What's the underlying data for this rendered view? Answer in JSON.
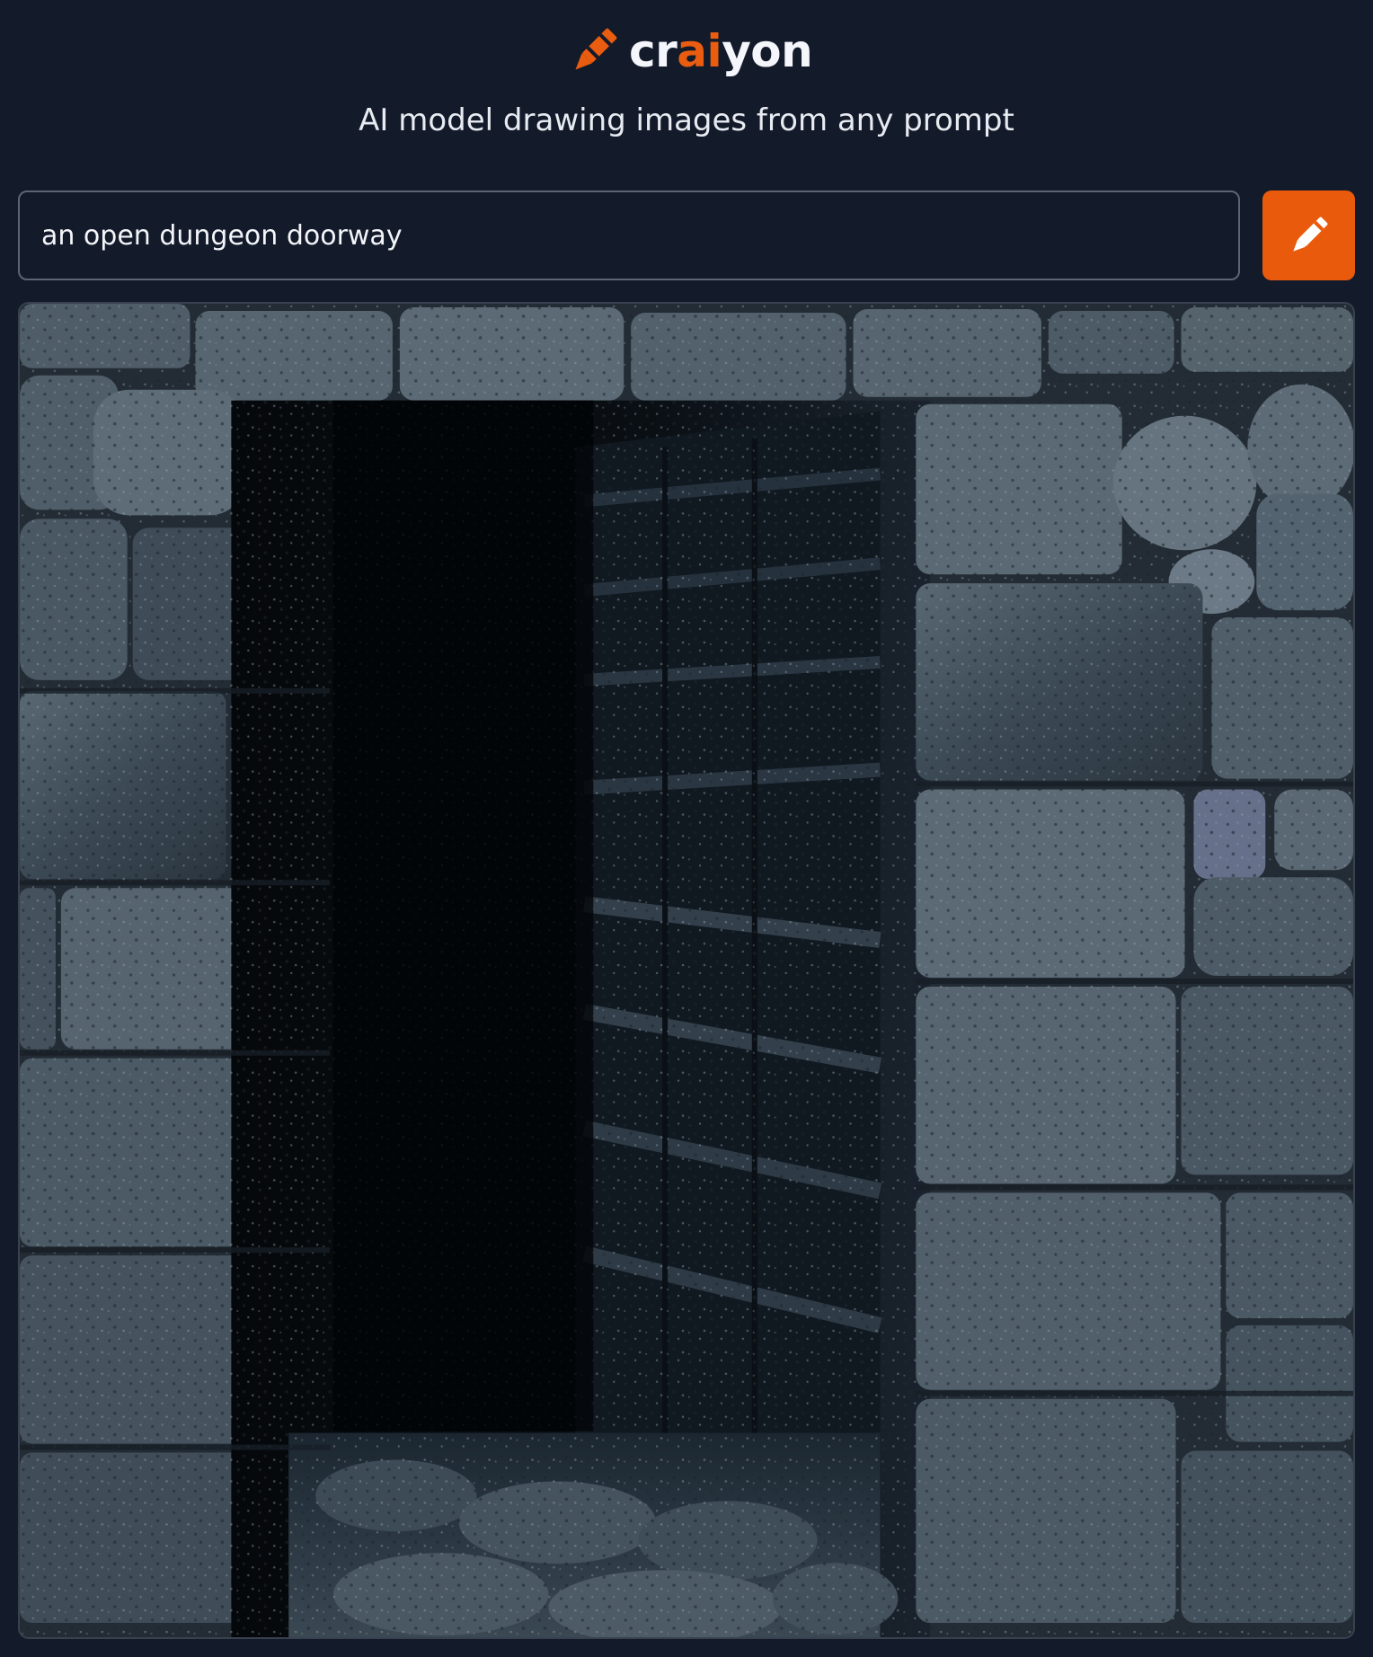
{
  "app": {
    "name_parts": [
      "cr",
      "ai",
      "yon"
    ],
    "tagline": "AI model drawing images from any prompt",
    "accent_color": "#ea5c0f",
    "background_color": "#131a2a",
    "logo_icon": "crayon-icon"
  },
  "prompt": {
    "value": "an open dungeon doorway",
    "placeholder": ""
  },
  "draw_button": {
    "icon": "pencil-icon",
    "color": "#ea5a0c"
  },
  "result_image": {
    "description_icon": "generated-image"
  }
}
